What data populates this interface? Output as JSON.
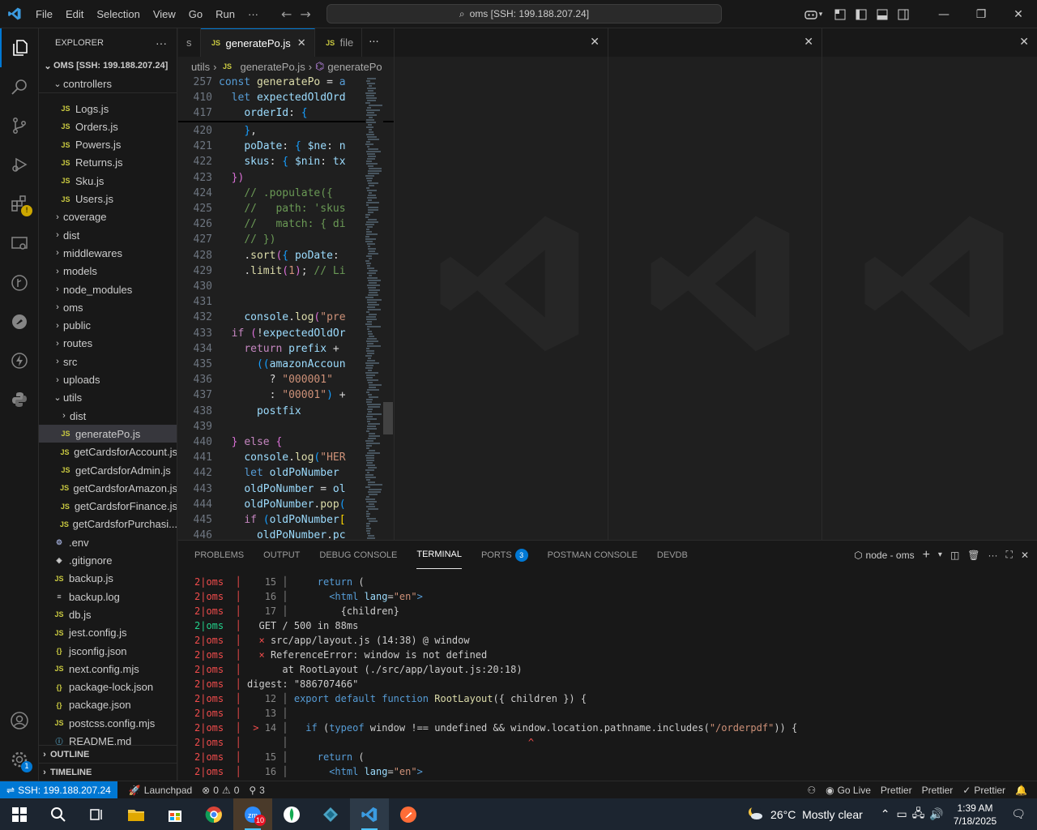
{
  "titlebar": {
    "menu": [
      "File",
      "Edit",
      "Selection",
      "View",
      "Go",
      "Run",
      "···"
    ],
    "command_center": "oms [SSH: 199.188.207.24]"
  },
  "sidebar": {
    "header": "EXPLORER",
    "root": "OMS [SSH: 199.188.207.24]",
    "controllers_label": "controllers",
    "outline": "OUTLINE",
    "timeline": "TIMELINE",
    "items": [
      {
        "label": "Logs.js",
        "icon": "JS"
      },
      {
        "label": "Orders.js",
        "icon": "JS"
      },
      {
        "label": "Powers.js",
        "icon": "JS"
      },
      {
        "label": "Returns.js",
        "icon": "JS"
      },
      {
        "label": "Sku.js",
        "icon": "JS"
      },
      {
        "label": "Users.js",
        "icon": "JS"
      },
      {
        "label": "coverage",
        "icon": "folder"
      },
      {
        "label": "dist",
        "icon": "folder"
      },
      {
        "label": "middlewares",
        "icon": "folder"
      },
      {
        "label": "models",
        "icon": "folder"
      },
      {
        "label": "node_modules",
        "icon": "folder"
      },
      {
        "label": "oms",
        "icon": "folder"
      },
      {
        "label": "public",
        "icon": "folder"
      },
      {
        "label": "routes",
        "icon": "folder"
      },
      {
        "label": "src",
        "icon": "folder"
      },
      {
        "label": "uploads",
        "icon": "folder"
      },
      {
        "label": "utils",
        "icon": "folder-open"
      },
      {
        "label": "dist",
        "icon": "folder"
      },
      {
        "label": "generatePo.js",
        "icon": "JS"
      },
      {
        "label": "getCardsforAccount.js",
        "icon": "JS"
      },
      {
        "label": "getCardsforAdmin.js",
        "icon": "JS"
      },
      {
        "label": "getCardsforAmazon.js",
        "icon": "JS"
      },
      {
        "label": "getCardsforFinance.js",
        "icon": "JS"
      },
      {
        "label": "getCardsforPurchasi...",
        "icon": "JS"
      },
      {
        "label": ".env",
        "icon": "gear"
      },
      {
        "label": ".gitignore",
        "icon": "git"
      },
      {
        "label": "backup.js",
        "icon": "JS"
      },
      {
        "label": "backup.log",
        "icon": "log"
      },
      {
        "label": "db.js",
        "icon": "JS"
      },
      {
        "label": "jest.config.js",
        "icon": "JS"
      },
      {
        "label": "jsconfig.json",
        "icon": "{}"
      },
      {
        "label": "next.config.mjs",
        "icon": "JS"
      },
      {
        "label": "package-lock.json",
        "icon": "{}"
      },
      {
        "label": "package.json",
        "icon": "{}"
      },
      {
        "label": "postcss.config.mjs",
        "icon": "JS"
      },
      {
        "label": "README.md",
        "icon": "info"
      }
    ]
  },
  "editor": {
    "tabs": [
      {
        "label": "s"
      },
      {
        "label": "generatePo.js",
        "icon": "JS",
        "active": true
      },
      {
        "label": "file",
        "icon": "JS"
      }
    ],
    "breadcrumb": [
      "utils",
      "generatePo.js",
      "generatePo"
    ],
    "lines": [
      {
        "n": "257",
        "html": "<span class='k'>const</span> <span class='f'>generatePo</span> <span class='p'>=</span> <span class='k'>a</span>"
      },
      {
        "n": "410",
        "html": "  <span class='k'>let</span> <span class='v'>expectedOldOrd</span>"
      },
      {
        "n": "417",
        "html": "    <span class='v'>orderId</span><span class='p'>:</span> <span class='b3'>{</span>"
      },
      {
        "n": "420",
        "html": "    <span class='b3'>}</span><span class='p'>,</span>"
      },
      {
        "n": "421",
        "html": "    <span class='v'>poDate</span><span class='p'>:</span> <span class='b3'>{</span> <span class='v'>$ne</span><span class='p'>:</span> <span class='v'>n</span>"
      },
      {
        "n": "422",
        "html": "    <span class='v'>skus</span><span class='p'>:</span> <span class='b3'>{</span> <span class='v'>$nin</span><span class='p'>:</span> <span class='v'>tx</span>"
      },
      {
        "n": "423",
        "html": "  <span class='b2'>})</span>"
      },
      {
        "n": "424",
        "html": "    <span class='c'>// .populate({</span>"
      },
      {
        "n": "425",
        "html": "    <span class='c'>//   path: 'skus</span>"
      },
      {
        "n": "426",
        "html": "    <span class='c'>//   match: { di</span>"
      },
      {
        "n": "427",
        "html": "    <span class='c'>// })</span>"
      },
      {
        "n": "428",
        "html": "    <span class='p'>.</span><span class='f'>sort</span><span class='b2'>(</span><span class='b3'>{</span> <span class='v'>poDate</span><span class='p'>:</span>"
      },
      {
        "n": "429",
        "html": "    <span class='p'>.</span><span class='f'>limit</span><span class='b2'>(</span><span class='s'>1</span><span class='b2'>)</span><span class='p'>;</span> <span class='c'>// Li</span>"
      },
      {
        "n": "430",
        "html": ""
      },
      {
        "n": "431",
        "html": ""
      },
      {
        "n": "432",
        "html": "    <span class='v'>console</span><span class='p'>.</span><span class='f'>log</span><span class='b2'>(</span><span class='s'>\"pre</span>"
      },
      {
        "n": "433",
        "html": "  <span class='kc'>if</span> <span class='b2'>(</span><span class='p'>!</span><span class='v'>expectedOldOr</span>"
      },
      {
        "n": "434",
        "html": "    <span class='kc'>return</span> <span class='v'>prefix</span> <span class='p'>+</span>"
      },
      {
        "n": "435",
        "html": "      <span class='b3'>((</span><span class='v'>amazonAccoun</span>"
      },
      {
        "n": "436",
        "html": "        <span class='p'>?</span> <span class='s'>\"000001\"</span>"
      },
      {
        "n": "437",
        "html": "        <span class='p'>:</span> <span class='s'>\"00001\"</span><span class='b3'>)</span> <span class='p'>+</span>"
      },
      {
        "n": "438",
        "html": "      <span class='v'>postfix</span>"
      },
      {
        "n": "439",
        "html": ""
      },
      {
        "n": "440",
        "html": "  <span class='b2'>}</span> <span class='kc'>else</span> <span class='b2'>{</span>"
      },
      {
        "n": "441",
        "html": "    <span class='v'>console</span><span class='p'>.</span><span class='f'>log</span><span class='b3'>(</span><span class='s'>\"HER</span>"
      },
      {
        "n": "442",
        "html": "    <span class='k'>let</span> <span class='v'>oldPoNumber</span>"
      },
      {
        "n": "443",
        "html": "    <span class='v'>oldPoNumber</span> <span class='p'>=</span> <span class='v'>ol</span>"
      },
      {
        "n": "444",
        "html": "    <span class='v'>oldPoNumber</span><span class='p'>.</span><span class='f'>pop</span><span class='b3'>(</span>"
      },
      {
        "n": "445",
        "html": "    <span class='kc'>if</span> <span class='b3'>(</span><span class='v'>oldPoNumber</span><span class='b1'>[</span>"
      },
      {
        "n": "446",
        "html": "      <span class='v'>oldPoNumber</span><span class='p'>.</span><span class='v'>pc</span>"
      }
    ]
  },
  "panel": {
    "tabs": [
      "PROBLEMS",
      "OUTPUT",
      "DEBUG CONSOLE",
      "TERMINAL",
      "PORTS",
      "POSTMAN CONSOLE",
      "DEVDB"
    ],
    "active_tab": "TERMINAL",
    "ports_badge": "3",
    "terminal_name": "node - oms",
    "terminal": [
      {
        "pfx": "2|oms",
        "g": false,
        "body": "<span class='tgut'>   15 │</span>     <span class='k'>return</span> ("
      },
      {
        "pfx": "2|oms",
        "g": false,
        "body": "<span class='tgut'>   16 │</span>       <span class='k'>&lt;html</span> <span class='v'>lang</span>=<span class='s'>\"en\"</span><span class='k'>&gt;</span>"
      },
      {
        "pfx": "2|oms",
        "g": false,
        "body": "<span class='tgut'>   17 │</span>         {children}"
      },
      {
        "pfx": "2|oms",
        "g": true,
        "body": "  GET / 500 in 88ms"
      },
      {
        "pfx": "2|oms",
        "g": false,
        "body": "  <span class='tsep'>×</span> src/app/layout.js (14:38) @ window"
      },
      {
        "pfx": "2|oms",
        "g": false,
        "body": "  <span class='tsep'>×</span> ReferenceError: window is not defined"
      },
      {
        "pfx": "2|oms",
        "g": false,
        "body": "      at RootLayout (./src/app/layout.js:20:18)"
      },
      {
        "pfx": "2|oms",
        "g": false,
        "body": "digest: \"886707466\""
      },
      {
        "pfx": "2|oms",
        "g": false,
        "body": "<span class='tgut'>   12 │</span> <span class='k'>export default function</span> <span class='f'>RootLayout</span>({ children }) {"
      },
      {
        "pfx": "2|oms",
        "g": false,
        "body": "<span class='tgut'>   13 │</span>"
      },
      {
        "pfx": "2|oms",
        "g": false,
        "body": "<span class='tsep'> &gt;</span><span class='tgut'> 14 │</span>   <span class='k'>if</span> (<span class='k'>typeof</span> window !== undefined &amp;&amp; window.location.pathname.includes(<span class='s'>\"/orderpdf\"</span>)) {"
      },
      {
        "pfx": "2|oms",
        "g": false,
        "body": "<span class='tgut'>      │</span>                                         <span class='caret'>^</span>"
      },
      {
        "pfx": "2|oms",
        "g": false,
        "body": "<span class='tgut'>   15 │</span>     <span class='k'>return</span> ("
      },
      {
        "pfx": "2|oms",
        "g": false,
        "body": "<span class='tgut'>   16 │</span>       <span class='k'>&lt;html</span> <span class='v'>lang</span>=<span class='s'>\"en\"</span><span class='k'>&gt;</span>"
      }
    ]
  },
  "statusbar": {
    "remote": "SSH: 199.188.207.24",
    "launchpad": "Launchpad",
    "errors": "0",
    "warnings": "0",
    "ports": "3",
    "golive": "Go Live",
    "prettier1": "Prettier",
    "prettier2": "Prettier",
    "prettier3": "Prettier"
  },
  "taskbar": {
    "weather": "26°C  Mostly clear",
    "time": "1:39 AM",
    "date": "7/18/2025",
    "zoom_badge": "10"
  },
  "colors": {
    "accent": "#0078d4",
    "editor_bg": "#1f1f1f",
    "sidebar_bg": "#181818",
    "error": "#f14c4c",
    "success": "#23d18b"
  }
}
